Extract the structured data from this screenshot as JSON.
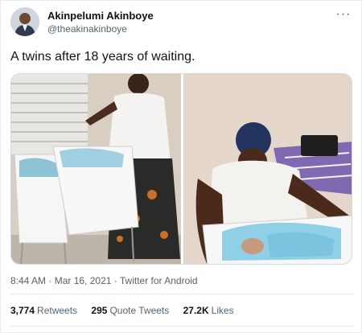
{
  "user": {
    "display_name": "Akinpelumi Akinboye",
    "handle": "@theakinakinboye"
  },
  "menu_icon": "more-horizontal-icon",
  "tweet": {
    "text": "A twins after 18 years of waiting."
  },
  "meta": {
    "time": "8:44 AM",
    "separator1": " · ",
    "date": "Mar 16, 2021",
    "separator2": " · ",
    "source": "Twitter for Android"
  },
  "stats": {
    "retweets_count": "3,774",
    "retweets_label": "Retweets",
    "quotes_count": "295",
    "quotes_label": "Quote Tweets",
    "likes_count": "27.2K",
    "likes_label": "Likes"
  }
}
